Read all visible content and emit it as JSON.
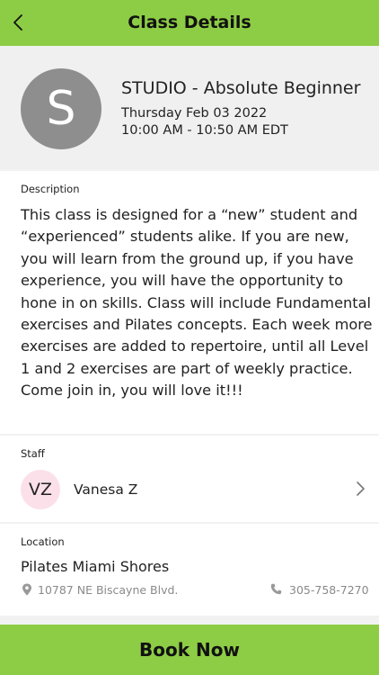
{
  "header": {
    "title": "Class Details",
    "back_icon": "chevron-left-icon"
  },
  "class_info": {
    "avatar_letter": "S",
    "name": "STUDIO - Absolute Beginner",
    "date": "Thursday Feb 03 2022",
    "time": "10:00 AM - 10:50 AM EDT"
  },
  "description": {
    "label": "Description",
    "text": "This class is designed for a “new” student and “experienced” students alike. If you are new, you will learn from the ground up, if you have experience, you will have the opportunity to hone in on skills. Class will include Fundamental exercises and Pilates concepts. Each week more exercises are added to repertoire, until all Level 1 and 2 exercises are part of weekly practice. Come join in, you will love it!!!"
  },
  "staff": {
    "label": "Staff",
    "initials": "VZ",
    "name": "Vanesa Z",
    "chevron_icon": "chevron-right-icon"
  },
  "location": {
    "label": "Location",
    "name": "Pilates Miami Shores",
    "address": "10787 NE Biscayne Blvd.",
    "address_icon": "map-pin-icon",
    "phone": "305-758-7270",
    "phone_icon": "phone-icon"
  },
  "actions": {
    "book_label": "Book Now"
  },
  "colors": {
    "accent": "#8dcc45",
    "avatar_gray": "#8e8e8e",
    "staff_avatar_bg": "#fbe0ea",
    "muted_text": "#8a8a8a"
  }
}
